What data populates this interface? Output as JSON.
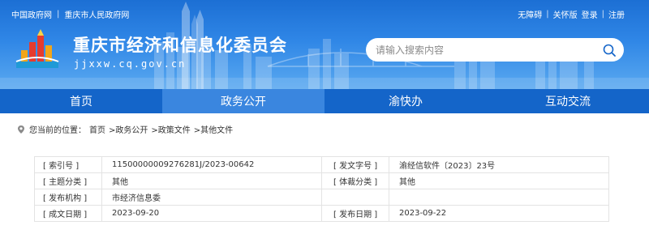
{
  "header": {
    "top_links": [
      "中国政府网",
      "重庆市人民政府网"
    ],
    "top_right": {
      "accessible": "无障碍",
      "care": "关怀版",
      "login": "登录",
      "register": "注册"
    },
    "title": "重庆市经济和信息化委员会",
    "domain": "jjxxw.cq.gov.cn",
    "search_placeholder": "请输入搜索内容"
  },
  "nav": {
    "items": [
      "首页",
      "政务公开",
      "渝快办",
      "互动交流"
    ],
    "active_index": 1
  },
  "breadcrumb": {
    "prefix": "您当前的位置：",
    "items": [
      "首页",
      ">政务公开",
      ">政策文件",
      ">其他文件"
    ]
  },
  "info": {
    "rows": [
      {
        "l1": "[ 索引号 ]",
        "v1": "11500000009276281J/2023-00642",
        "l2": "[ 发文字号 ]",
        "v2": "渝经信软件〔2023〕23号"
      },
      {
        "l1": "[ 主题分类 ]",
        "v1": "其他",
        "l2": "[ 体裁分类 ]",
        "v2": "其他"
      },
      {
        "l1": "[ 发布机构 ]",
        "v1": "市经济信息委",
        "l2": "",
        "v2": ""
      },
      {
        "l1": "[ 成文日期 ]",
        "v1": "2023-09-20",
        "l2": "[ 发布日期 ]",
        "v2": "2023-09-22"
      }
    ]
  },
  "colors": {
    "header_blue": "#1c6fd4",
    "nav_blue": "#1465c9",
    "nav_active": "#3a86df"
  }
}
